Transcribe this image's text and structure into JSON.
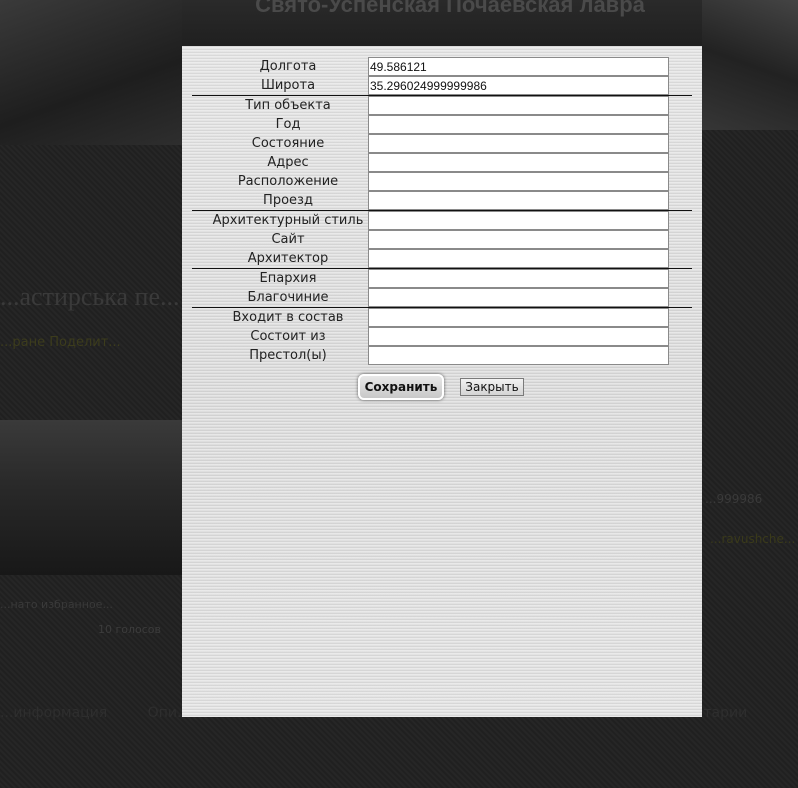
{
  "background": {
    "site_title": "Свято-Успенская Почаевская лавра",
    "page_title": "...астирська пе...",
    "links_text": "...ране    Поделит...",
    "right_text_1": "...999986",
    "right_text_2": "...ravushche...",
    "small_line": "...нато избранное...",
    "votes": "10 голосов",
    "tabs": [
      "...информация",
      "Опи...",
      "...",
      "...тарии"
    ]
  },
  "form": {
    "fields": [
      {
        "label": "Долгота",
        "value": "49.586121"
      },
      {
        "label": "Широта",
        "value": "35.296024999999986"
      },
      {
        "label": "Тип объекта",
        "value": ""
      },
      {
        "label": "Год",
        "value": ""
      },
      {
        "label": "Состояние",
        "value": ""
      },
      {
        "label": "Адрес",
        "value": ""
      },
      {
        "label": "Расположение",
        "value": ""
      },
      {
        "label": "Проезд",
        "value": ""
      },
      {
        "label": "Архитектурный стиль",
        "value": ""
      },
      {
        "label": "Сайт",
        "value": ""
      },
      {
        "label": "Архитектор",
        "value": ""
      },
      {
        "label": "Епархия",
        "value": ""
      },
      {
        "label": "Благочиние",
        "value": ""
      },
      {
        "label": "Входит в состав",
        "value": ""
      },
      {
        "label": "Состоит из",
        "value": ""
      },
      {
        "label": "Престол(ы)",
        "value": ""
      }
    ],
    "save_label": "Сохранить",
    "close_label": "Закрыть"
  }
}
